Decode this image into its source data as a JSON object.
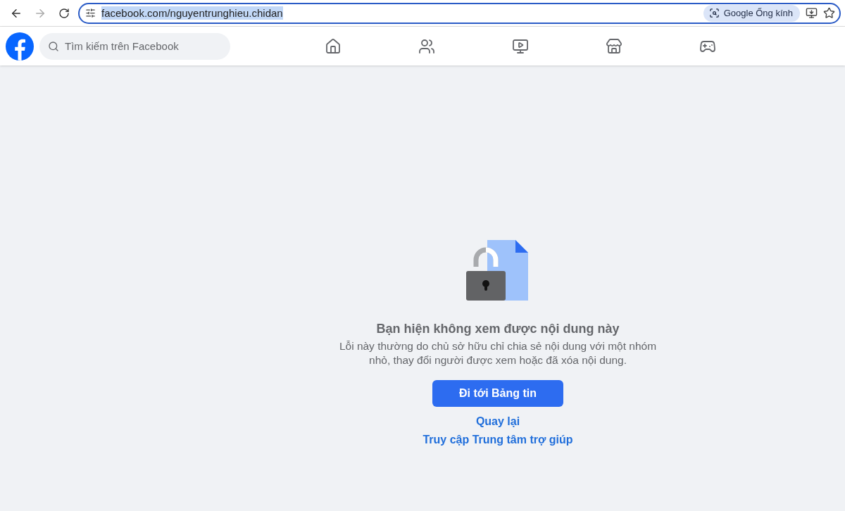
{
  "browser": {
    "url": "facebook.com/nguyentrunghieu.chidan",
    "lens_chip": "Google Ống kính"
  },
  "header": {
    "search": {
      "placeholder": "Tìm kiếm trên Facebook"
    }
  },
  "message": {
    "title": "Bạn hiện không xem được nội dung này",
    "body": "Lỗi này thường do chủ sở hữu chỉ chia sẻ nội dung với một nhóm nhỏ, thay đổi người được xem hoặc đã xóa nội dung.",
    "primary_button": "Đi tới Bảng tin",
    "links": [
      "Quay lại",
      "Truy cập Trung tâm trợ giúp"
    ]
  }
}
